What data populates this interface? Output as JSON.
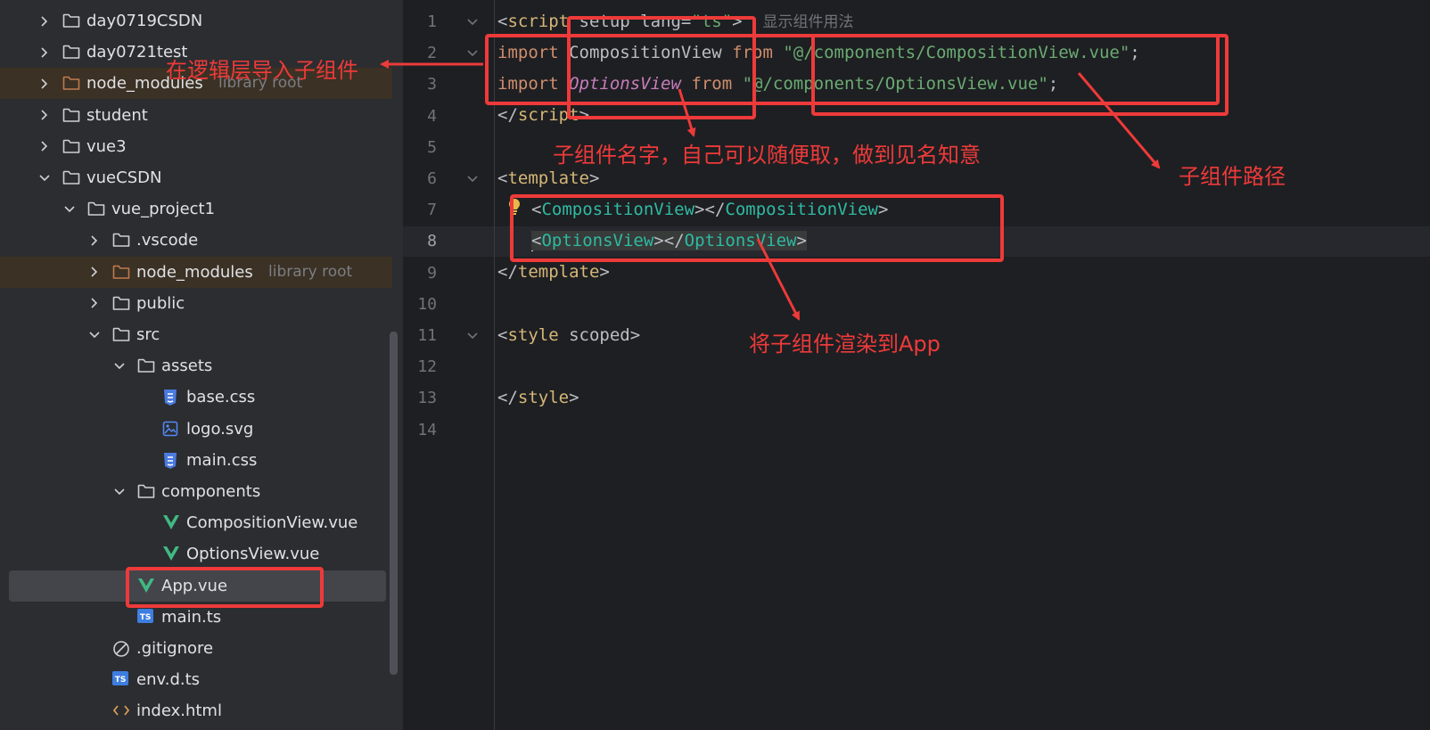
{
  "project_tree": {
    "items": [
      {
        "label": "day0719CSDN",
        "type": "folder",
        "depth": 0,
        "expanded": false
      },
      {
        "label": "day0721test",
        "type": "folder",
        "depth": 0,
        "expanded": false
      },
      {
        "label": "node_modules",
        "hint": "library root",
        "type": "folder-excluded",
        "depth": 0,
        "expanded": false
      },
      {
        "label": "student",
        "type": "folder",
        "depth": 0,
        "expanded": false
      },
      {
        "label": "vue3",
        "type": "folder",
        "depth": 0,
        "expanded": false
      },
      {
        "label": "vueCSDN",
        "type": "folder",
        "depth": 0,
        "expanded": true
      },
      {
        "label": "vue_project1",
        "type": "folder",
        "depth": 1,
        "expanded": true
      },
      {
        "label": ".vscode",
        "type": "folder",
        "depth": 2,
        "expanded": false
      },
      {
        "label": "node_modules",
        "hint": "library root",
        "type": "folder-excluded",
        "depth": 2,
        "expanded": false
      },
      {
        "label": "public",
        "type": "folder",
        "depth": 2,
        "expanded": false
      },
      {
        "label": "src",
        "type": "folder",
        "depth": 2,
        "expanded": true
      },
      {
        "label": "assets",
        "type": "folder",
        "depth": 3,
        "expanded": true
      },
      {
        "label": "base.css",
        "type": "css",
        "depth": 4
      },
      {
        "label": "logo.svg",
        "type": "image",
        "depth": 4
      },
      {
        "label": "main.css",
        "type": "css",
        "depth": 4
      },
      {
        "label": "components",
        "type": "folder",
        "depth": 3,
        "expanded": true
      },
      {
        "label": "CompositionView.vue",
        "type": "vue",
        "depth": 4
      },
      {
        "label": "OptionsView.vue",
        "type": "vue",
        "depth": 4
      },
      {
        "label": "App.vue",
        "type": "vue",
        "depth": 3,
        "selected": true
      },
      {
        "label": "main.ts",
        "type": "ts",
        "depth": 3
      },
      {
        "label": ".gitignore",
        "type": "ignore",
        "depth": 2
      },
      {
        "label": "env.d.ts",
        "type": "ts",
        "depth": 2
      },
      {
        "label": "index.html",
        "type": "html",
        "depth": 2
      }
    ]
  },
  "editor": {
    "line_numbers": [
      "1",
      "2",
      "3",
      "4",
      "5",
      "6",
      "7",
      "8",
      "9",
      "10",
      "11",
      "12",
      "13",
      "14"
    ],
    "current_line": "8",
    "code": {
      "l1_open": "<",
      "l1_tag": "script",
      "l1_attrs": " setup lang=",
      "l1_val": "\"ts\"",
      "l1_close": ">",
      "l1_inlay": "显示组件用法",
      "import_kw": "import",
      "l2_name": "CompositionView",
      "from_kw": "from",
      "l2_path": "\"@/components/CompositionView.vue\"",
      "semi": ";",
      "l3_name": "OptionsView",
      "l3_path": "\"@/components/OptionsView.vue\"",
      "end_open": "</",
      "template_tag": "template",
      "comp_a": "CompositionView",
      "comp_b": "OptionsView",
      "style_tag": "style",
      "scoped_attr": " scoped",
      "lt": "<",
      "gt": ">",
      "lts": "</"
    }
  },
  "annotations": {
    "import_note": "在逻辑层导入子组件",
    "name_note": "子组件名字，自己可以随便取，做到见名知意",
    "path_note": "子组件路径",
    "render_note": "将子组件渲染到App"
  },
  "colors": {
    "annotation": "#ee3a3a",
    "vue_icon": "#41b883",
    "folder": "#ced0d6",
    "folder_excluded": "#c07a4f"
  }
}
